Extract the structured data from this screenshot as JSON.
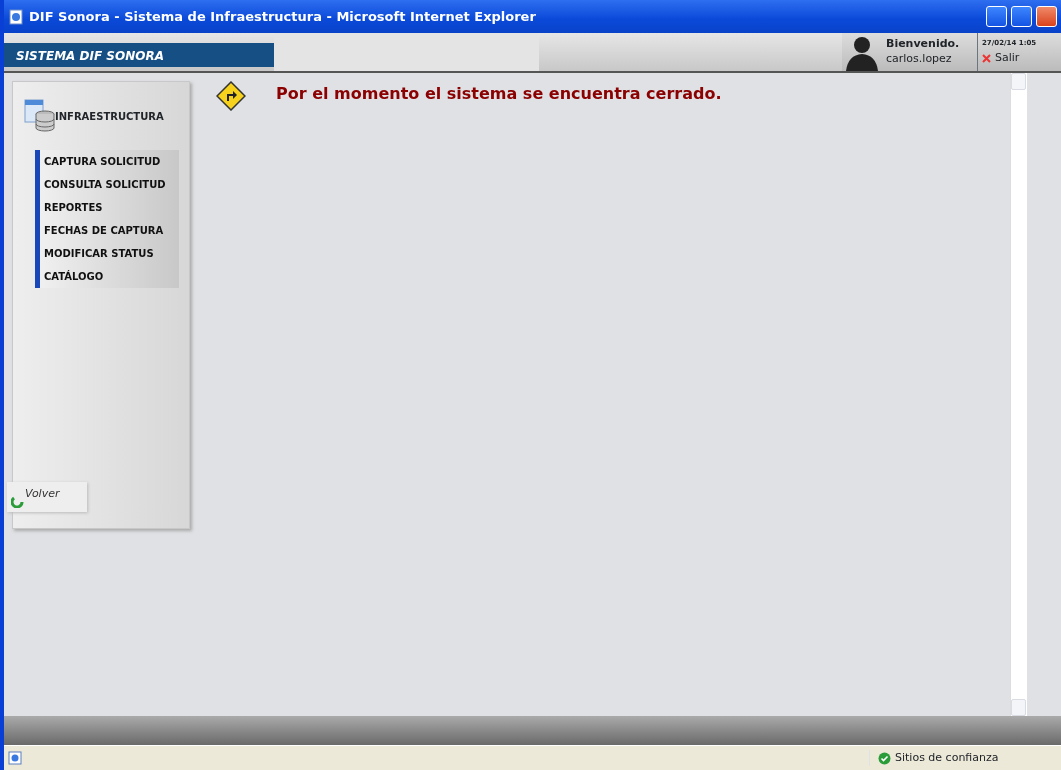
{
  "window": {
    "title": "DIF Sonora - Sistema de Infraestructura - Microsoft Internet Explorer"
  },
  "header": {
    "brand": "SISTEMA DIF SONORA",
    "greeting": "Bienvenido.",
    "user": "carlos.lopez",
    "datetime": "27/02/14 1:05",
    "logout": "Salir"
  },
  "sidebar": {
    "section": "INFRAESTRUCTURA",
    "items": [
      {
        "label": "CAPTURA SOLICITUD"
      },
      {
        "label": "CONSULTA SOLICITUD"
      },
      {
        "label": "REPORTES"
      },
      {
        "label": "FECHAS DE CAPTURA"
      },
      {
        "label": "MODIFICAR STATUS"
      },
      {
        "label": "CATÁLOGO"
      }
    ],
    "back": "Volver"
  },
  "message": "Por el momento el sistema se encuentra cerrado.",
  "status_bar": {
    "zone": "Sitios de confianza"
  }
}
